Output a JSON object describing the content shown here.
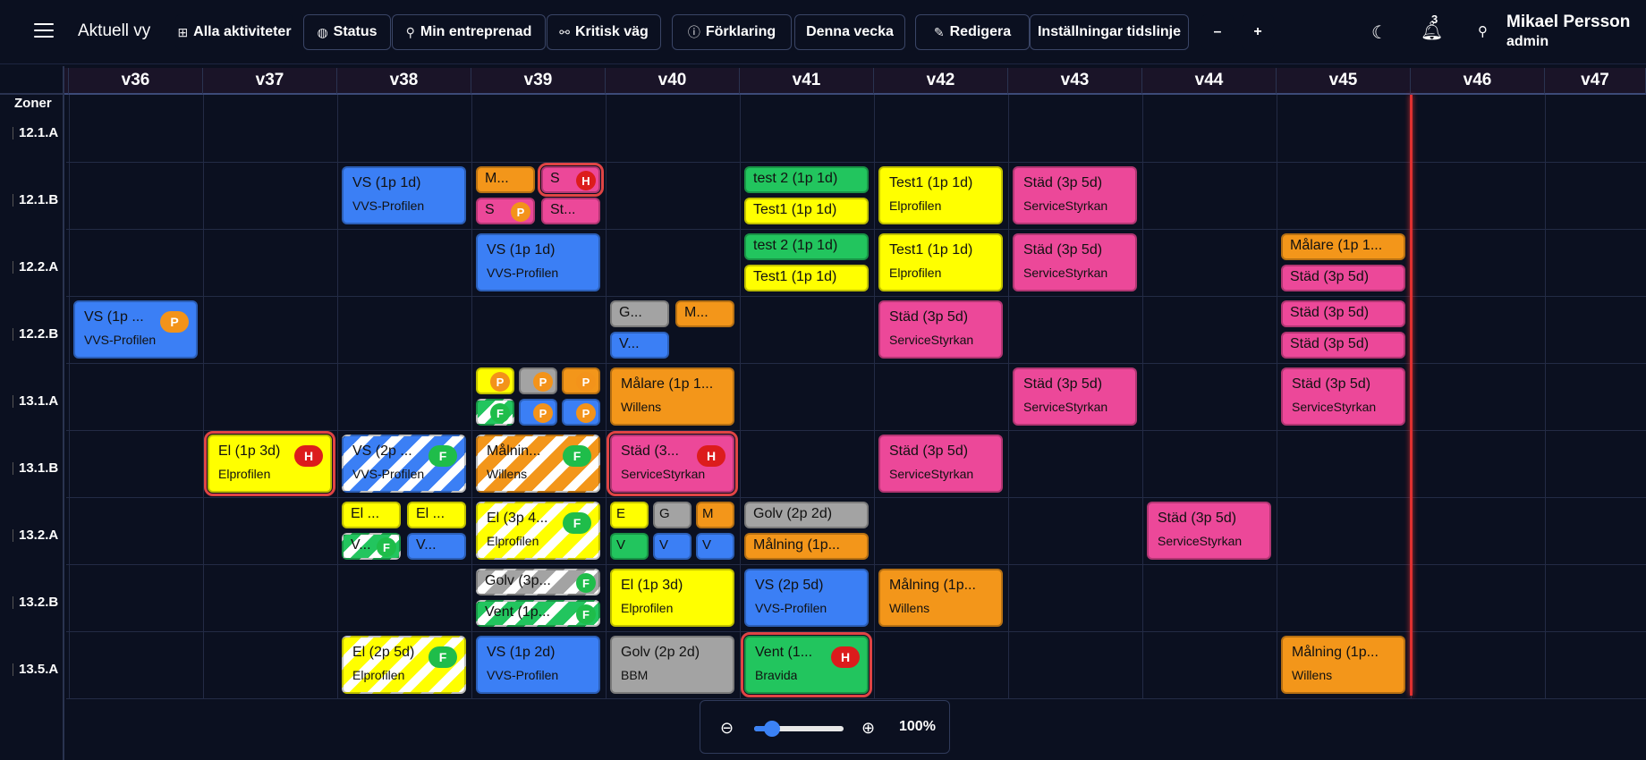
{
  "header": {
    "title": "Aktuell vy",
    "buttons": [
      {
        "name": "all-activities-button",
        "icon": "plus-square-icon",
        "glyph": "⊞",
        "label": "Alla aktiviteter",
        "flat": true
      },
      {
        "name": "status-button",
        "icon": "palette-icon",
        "glyph": "◍",
        "label": "Status"
      },
      {
        "name": "my-contractor-button",
        "icon": "user-icon",
        "glyph": "⚲",
        "label": "Min entreprenad"
      },
      {
        "name": "critical-path-button",
        "icon": "route-icon",
        "glyph": "⚯",
        "label": "Kritisk väg"
      },
      {
        "name": "legend-button",
        "icon": "info-icon",
        "glyph": "ⓘ",
        "label": "Förklaring"
      },
      {
        "name": "this-week-button",
        "icon": "",
        "glyph": "",
        "label": "Denna vecka"
      },
      {
        "name": "edit-button",
        "icon": "edit-icon",
        "glyph": "✎",
        "label": "Redigera"
      },
      {
        "name": "timeline-settings-button",
        "icon": "",
        "glyph": "",
        "label": "Inställningar tidslinje"
      },
      {
        "name": "zoom-minus-button",
        "icon": "",
        "glyph": "",
        "label": "–",
        "flat": true
      },
      {
        "name": "zoom-plus-button",
        "icon": "",
        "glyph": "",
        "label": "+",
        "flat": true
      }
    ],
    "notification_count": "3",
    "user": {
      "name": "Mikael Persson",
      "role": "admin"
    }
  },
  "grid": {
    "zones_label": "Zoner",
    "weeks": [
      "v36",
      "v37",
      "v38",
      "v39",
      "v40",
      "v41",
      "v42",
      "v43",
      "v44",
      "v45",
      "v46",
      "v47"
    ],
    "zones": [
      "12.1.A",
      "12.1.B",
      "12.2.A",
      "12.2.B",
      "13.1.A",
      "13.1.B",
      "13.2.A",
      "13.2.B",
      "13.5.A"
    ],
    "today_week_index": 10
  },
  "colors": {
    "blue": "#3b7ff5",
    "orange": "#f3961a",
    "pink": "#ec4899",
    "yellow": "#ffff00",
    "green": "#22c55e",
    "gray": "#a3a3a3",
    "critical": "#e04444"
  },
  "tasks": [
    {
      "zone": 1,
      "week": 2,
      "color": "blue",
      "title": "VS (1p 1d)",
      "sub": "VVS-Profilen"
    },
    {
      "zone": 1,
      "week": 3,
      "slot": "tl",
      "color": "orange",
      "title": "M..."
    },
    {
      "zone": 1,
      "week": 3,
      "slot": "tr",
      "color": "pink",
      "title": "S",
      "badge": "H",
      "critical": true
    },
    {
      "zone": 1,
      "week": 3,
      "slot": "bl",
      "color": "pink",
      "title": "S",
      "badge": "P"
    },
    {
      "zone": 1,
      "week": 3,
      "slot": "br",
      "color": "pink",
      "title": "St..."
    },
    {
      "zone": 1,
      "week": 5,
      "slot": "top",
      "color": "green",
      "title": "test 2 (1p 1d)"
    },
    {
      "zone": 1,
      "week": 5,
      "slot": "bot",
      "color": "yellow",
      "title": "Test1 (1p 1d)"
    },
    {
      "zone": 1,
      "week": 6,
      "color": "yellow",
      "title": "Test1 (1p 1d)",
      "sub": "Elprofilen"
    },
    {
      "zone": 1,
      "week": 7,
      "color": "pink",
      "title": "Städ (3p 5d)",
      "sub": "ServiceStyrkan"
    },
    {
      "zone": 2,
      "week": 3,
      "color": "blue",
      "title": "VS (1p 1d)",
      "sub": "VVS-Profilen"
    },
    {
      "zone": 2,
      "week": 5,
      "slot": "top",
      "color": "green",
      "title": "test 2 (1p 1d)"
    },
    {
      "zone": 2,
      "week": 5,
      "slot": "bot",
      "color": "yellow",
      "title": "Test1 (1p 1d)"
    },
    {
      "zone": 2,
      "week": 6,
      "color": "yellow",
      "title": "Test1 (1p 1d)",
      "sub": "Elprofilen"
    },
    {
      "zone": 2,
      "week": 7,
      "color": "pink",
      "title": "Städ (3p 5d)",
      "sub": "ServiceStyrkan"
    },
    {
      "zone": 2,
      "week": 9,
      "slot": "top",
      "color": "orange",
      "title": "Målare (1p 1..."
    },
    {
      "zone": 2,
      "week": 9,
      "slot": "bot",
      "color": "pink",
      "title": "Städ (3p 5d)"
    },
    {
      "zone": 3,
      "week": 0,
      "color": "blue",
      "title": "VS (1p ...",
      "sub": "VVS-Profilen",
      "badge": "P"
    },
    {
      "zone": 3,
      "week": 4,
      "slot": "tl",
      "color": "gray",
      "title": "G..."
    },
    {
      "zone": 3,
      "week": 4,
      "slot": "tr",
      "color": "orange",
      "title": "M..."
    },
    {
      "zone": 3,
      "week": 4,
      "slot": "bl",
      "color": "blue",
      "title": "V..."
    },
    {
      "zone": 3,
      "week": 6,
      "color": "pink",
      "title": "Städ (3p 5d)",
      "sub": "ServiceStyrkan"
    },
    {
      "zone": 3,
      "week": 9,
      "slot": "top",
      "color": "pink",
      "title": "Städ (3p 5d)"
    },
    {
      "zone": 3,
      "week": 9,
      "slot": "bot",
      "color": "pink",
      "title": "Städ (3p 5d)"
    },
    {
      "zone": 4,
      "week": 3,
      "slot": "t1",
      "color": "yellow",
      "title": "",
      "badge": "P"
    },
    {
      "zone": 4,
      "week": 3,
      "slot": "t2",
      "color": "gray",
      "title": "",
      "badge": "P"
    },
    {
      "zone": 4,
      "week": 3,
      "slot": "t3",
      "color": "orange",
      "title": "",
      "badge": "P"
    },
    {
      "zone": 4,
      "week": 3,
      "slot": "b1",
      "color": "green",
      "striped": true,
      "title": "",
      "badge": "F"
    },
    {
      "zone": 4,
      "week": 3,
      "slot": "b2",
      "color": "blue",
      "title": "",
      "badge": "P"
    },
    {
      "zone": 4,
      "week": 3,
      "slot": "b3",
      "color": "blue",
      "title": "",
      "badge": "P"
    },
    {
      "zone": 4,
      "week": 4,
      "color": "orange",
      "title": "Målare (1p 1...",
      "sub": "Willens"
    },
    {
      "zone": 4,
      "week": 7,
      "color": "pink",
      "title": "Städ (3p 5d)",
      "sub": "ServiceStyrkan"
    },
    {
      "zone": 4,
      "week": 9,
      "color": "pink",
      "title": "Städ (3p 5d)",
      "sub": "ServiceStyrkan"
    },
    {
      "zone": 5,
      "week": 1,
      "color": "yellow",
      "title": "El (1p 3d)",
      "sub": "Elprofilen",
      "badge": "H",
      "critical": true
    },
    {
      "zone": 5,
      "week": 2,
      "color": "blue",
      "striped": true,
      "title": "VS (2p ...",
      "sub": "VVS-Profilen",
      "badge": "F"
    },
    {
      "zone": 5,
      "week": 3,
      "color": "orange",
      "striped": true,
      "title": "Målnin...",
      "sub": "Willens",
      "badge": "F"
    },
    {
      "zone": 5,
      "week": 4,
      "color": "pink",
      "title": "Städ (3...",
      "sub": "ServiceStyrkan",
      "badge": "H",
      "critical": true
    },
    {
      "zone": 5,
      "week": 6,
      "color": "pink",
      "title": "Städ (3p 5d)",
      "sub": "ServiceStyrkan"
    },
    {
      "zone": 6,
      "week": 2,
      "slot": "tl",
      "color": "yellow",
      "title": "El ..."
    },
    {
      "zone": 6,
      "week": 2,
      "slot": "tr",
      "color": "yellow",
      "title": "El ..."
    },
    {
      "zone": 6,
      "week": 2,
      "slot": "bl",
      "color": "green",
      "striped": true,
      "title": "V...",
      "badge": "F"
    },
    {
      "zone": 6,
      "week": 2,
      "slot": "br",
      "color": "blue",
      "title": "V..."
    },
    {
      "zone": 6,
      "week": 3,
      "color": "yellow",
      "striped": true,
      "title": "El (3p 4...",
      "sub": "Elprofilen",
      "badge": "F"
    },
    {
      "zone": 6,
      "week": 4,
      "slot": "t1",
      "color": "yellow",
      "title": "E"
    },
    {
      "zone": 6,
      "week": 4,
      "slot": "t2",
      "color": "gray",
      "title": "G"
    },
    {
      "zone": 6,
      "week": 4,
      "slot": "t3",
      "color": "orange",
      "title": "M"
    },
    {
      "zone": 6,
      "week": 4,
      "slot": "b1",
      "color": "green",
      "title": "V"
    },
    {
      "zone": 6,
      "week": 4,
      "slot": "b2",
      "color": "blue",
      "title": "V"
    },
    {
      "zone": 6,
      "week": 4,
      "slot": "b3",
      "color": "blue",
      "title": "V"
    },
    {
      "zone": 6,
      "week": 5,
      "slot": "top",
      "color": "gray",
      "title": "Golv (2p 2d)"
    },
    {
      "zone": 6,
      "week": 5,
      "slot": "bot",
      "color": "orange",
      "title": "Målning (1p..."
    },
    {
      "zone": 6,
      "week": 8,
      "color": "pink",
      "title": "Städ (3p 5d)",
      "sub": "ServiceStyrkan"
    },
    {
      "zone": 7,
      "week": 3,
      "slot": "top",
      "color": "gray",
      "striped": true,
      "title": "Golv (3p...",
      "badge": "F"
    },
    {
      "zone": 7,
      "week": 3,
      "slot": "bot",
      "color": "green",
      "striped": true,
      "title": "Vent (1p...",
      "badge": "F"
    },
    {
      "zone": 7,
      "week": 4,
      "color": "yellow",
      "title": "El (1p 3d)",
      "sub": "Elprofilen"
    },
    {
      "zone": 7,
      "week": 5,
      "color": "blue",
      "title": "VS (2p 5d)",
      "sub": "VVS-Profilen"
    },
    {
      "zone": 7,
      "week": 6,
      "color": "orange",
      "title": "Målning (1p...",
      "sub": "Willens"
    },
    {
      "zone": 8,
      "week": 2,
      "color": "yellow",
      "striped": true,
      "title": "El (2p 5d)",
      "sub": "Elprofilen",
      "badge": "F"
    },
    {
      "zone": 8,
      "week": 3,
      "color": "blue",
      "title": "VS (1p 2d)",
      "sub": "VVS-Profilen"
    },
    {
      "zone": 8,
      "week": 4,
      "color": "gray",
      "title": "Golv (2p 2d)",
      "sub": "BBM"
    },
    {
      "zone": 8,
      "week": 5,
      "color": "green",
      "title": "Vent (1...",
      "sub": "Bravida",
      "badge": "H",
      "critical": true
    },
    {
      "zone": 8,
      "week": 9,
      "color": "orange",
      "title": "Målning (1p...",
      "sub": "Willens"
    }
  ],
  "zoom": {
    "value": "100%",
    "level": 0.2
  }
}
